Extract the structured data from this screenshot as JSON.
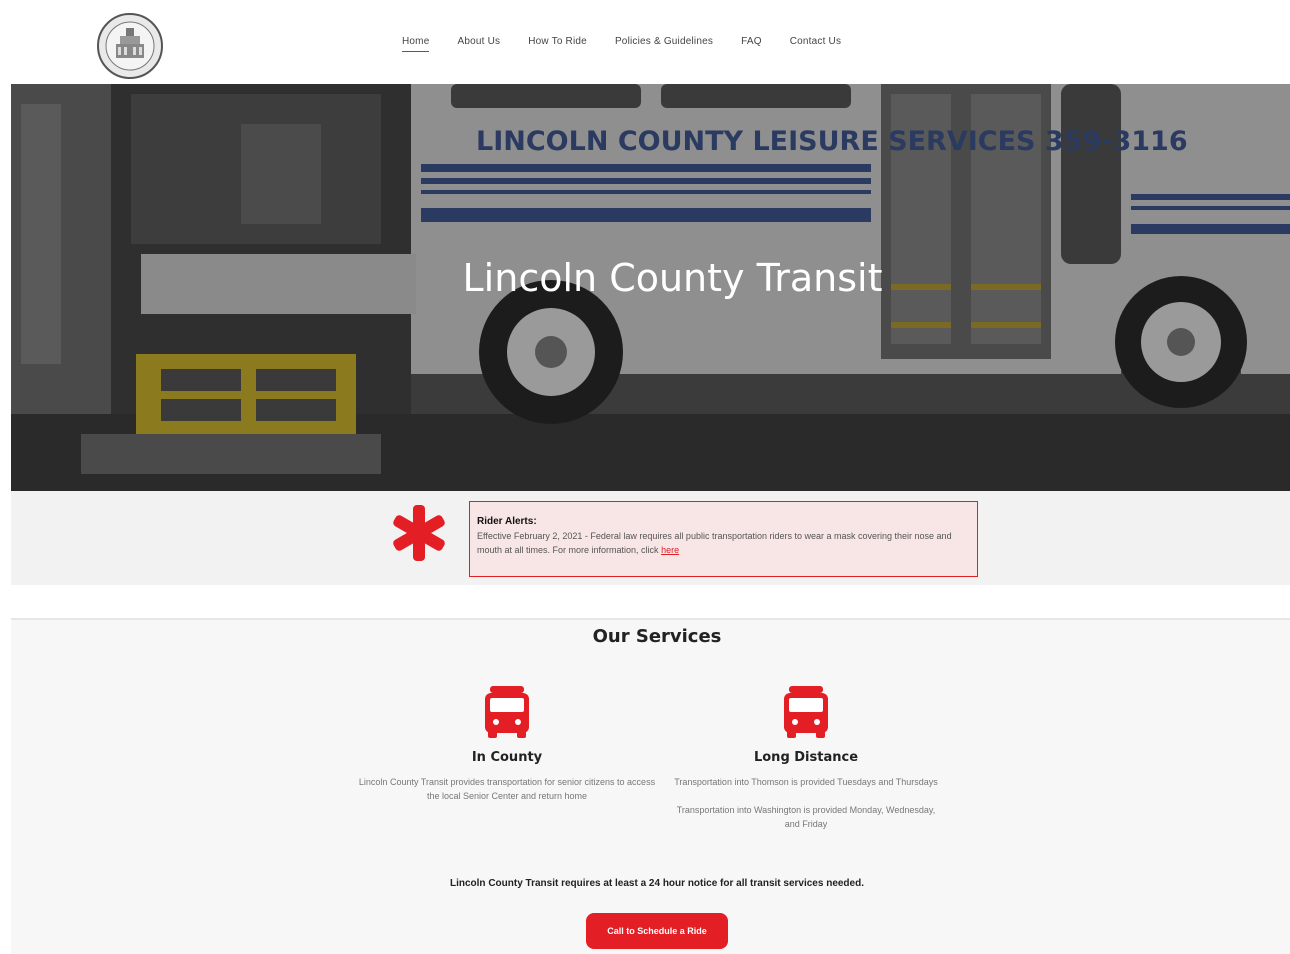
{
  "colors": {
    "accent": "#e31e24",
    "alert_bg": "#f8e6e6",
    "band_bg": "#f2f2f2"
  },
  "header": {
    "logo_icon": "county-seal-icon",
    "nav": [
      {
        "label": "Home",
        "active": true
      },
      {
        "label": "About Us"
      },
      {
        "label": "How To Ride"
      },
      {
        "label": "Policies & Guidelines"
      },
      {
        "label": "FAQ"
      },
      {
        "label": "Contact Us"
      }
    ]
  },
  "hero": {
    "title": "Lincoln County Transit",
    "bus_lettering": "LINCOLN COUNTY LEISURE SERVICES 359-3116"
  },
  "alert": {
    "icon": "asterisk-icon",
    "title": "Rider Alerts:",
    "text": "Effective February 2, 2021 - Federal law requires all public transportation riders to wear a mask covering their nose and mouth at all times. For more information, click ",
    "link": "here"
  },
  "services": {
    "title": "Our Services",
    "items": [
      {
        "icon": "bus-icon",
        "name": "In County",
        "desc": [
          "Lincoln County Transit provides transportation for senior citizens to access the local Senior Center and return home"
        ]
      },
      {
        "icon": "bus-icon",
        "name": "Long Distance",
        "desc": [
          "Transportation into Thomson is provided Tuesdays and Thursdays",
          "Transportation into Washington is provided Monday, Wednesday, and Friday"
        ]
      }
    ],
    "notice": "Lincoln County Transit requires at least a 24 hour notice for all transit services needed.",
    "cta": "Call to Schedule a Ride"
  }
}
